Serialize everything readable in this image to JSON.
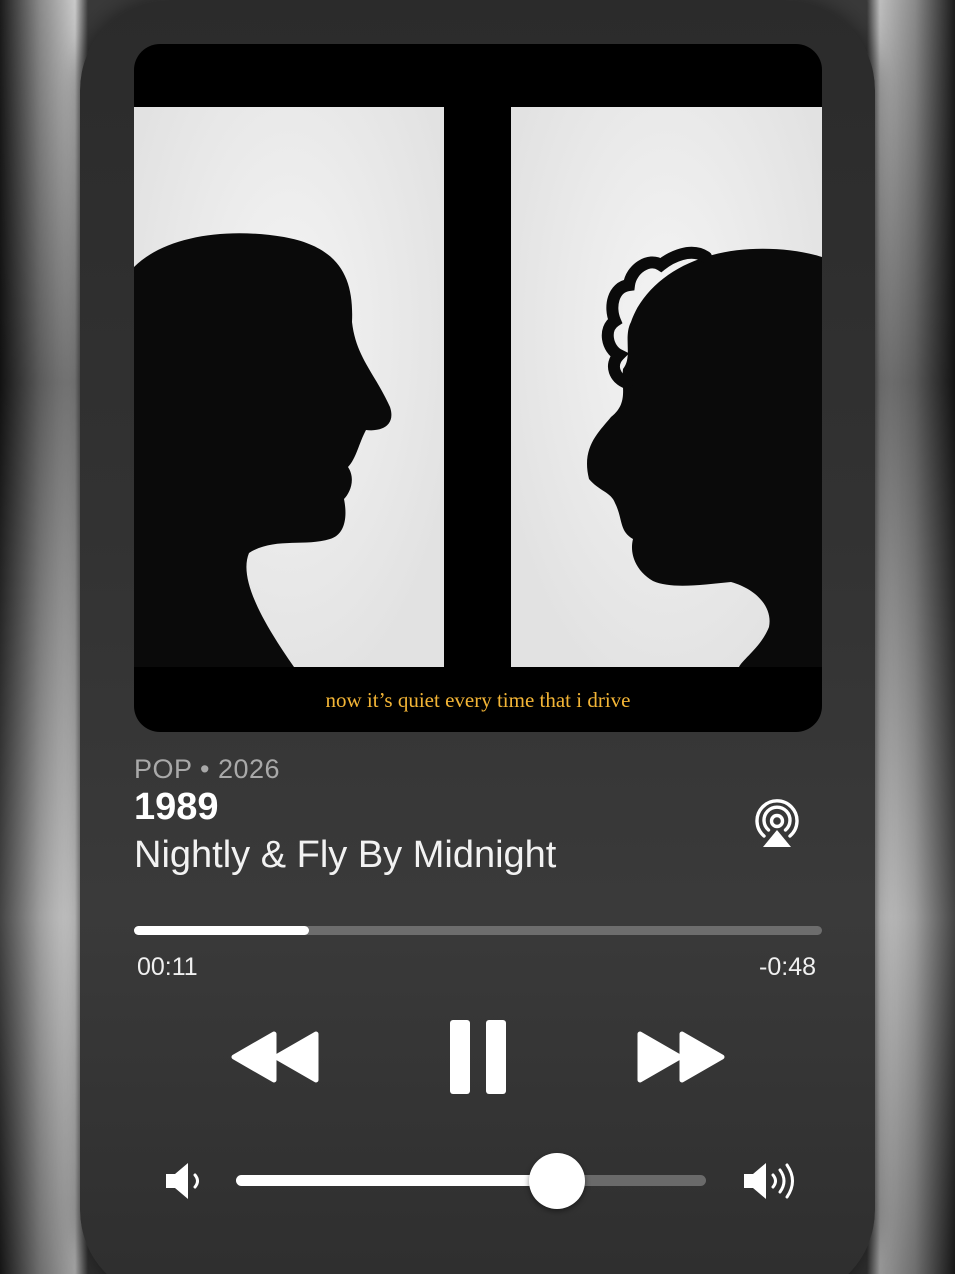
{
  "artwork": {
    "lyric_caption": "now it’s quiet every time that i drive",
    "caption_color": "#f3b536"
  },
  "track": {
    "genre_year": "POP • 2026",
    "title": "1989",
    "artist": "Nightly & Fly By Midnight"
  },
  "playback": {
    "elapsed": "00:11",
    "remaining": "-0:48",
    "progress_fraction": 0.254,
    "state": "playing"
  },
  "volume": {
    "level_fraction": 0.684
  },
  "icons": {
    "airplay": "airplay-icon",
    "rewind": "rewind-icon",
    "pause": "pause-icon",
    "forward": "fast-forward-icon",
    "volume_low": "volume-low-icon",
    "volume_high": "volume-high-icon"
  }
}
